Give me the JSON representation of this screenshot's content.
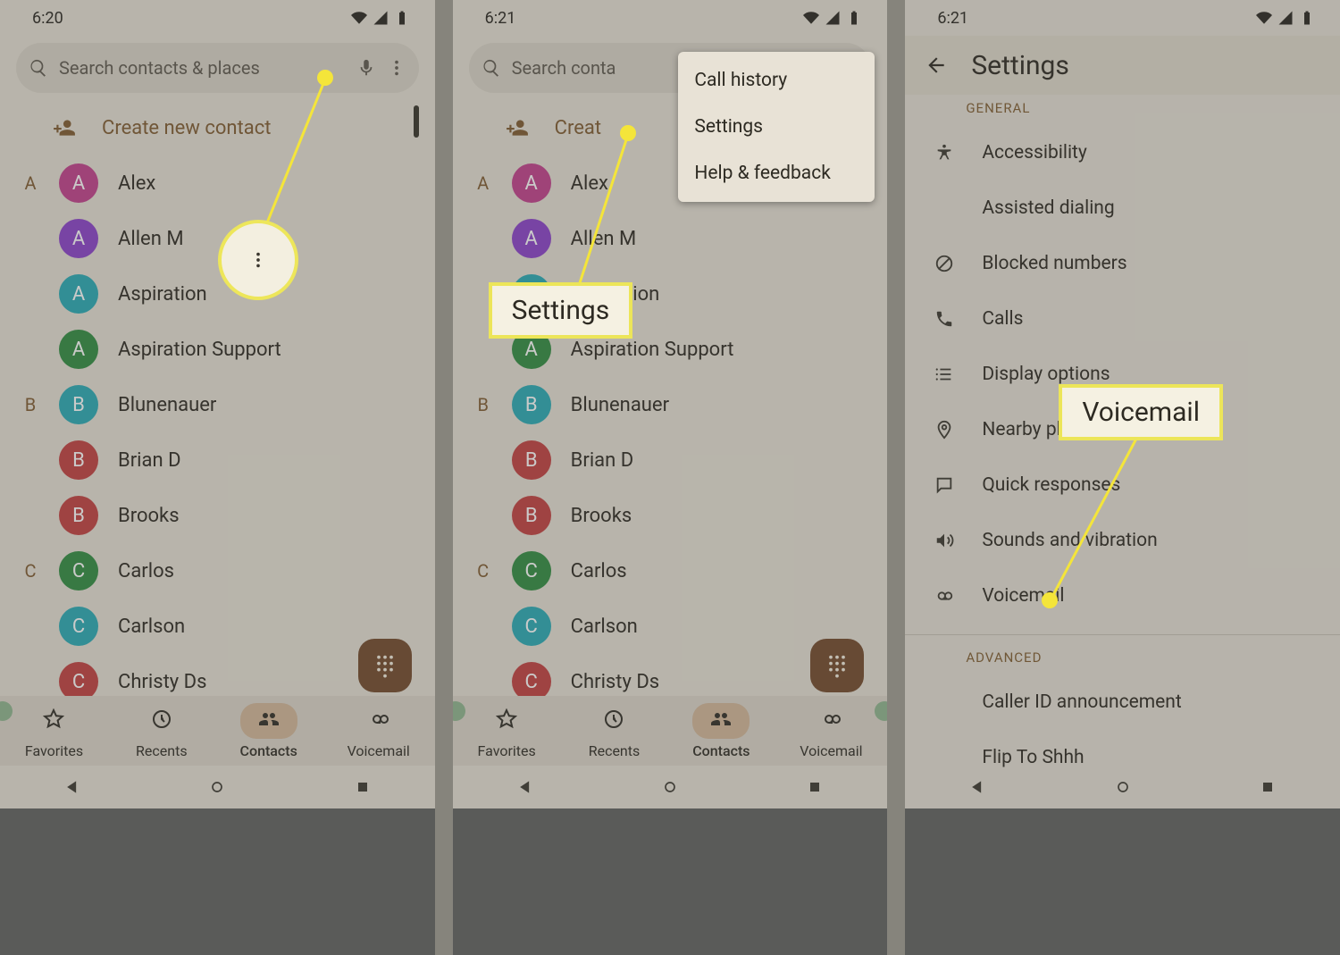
{
  "panels": [
    {
      "time": "6:20"
    },
    {
      "time": "6:21"
    },
    {
      "time": "6:21"
    }
  ],
  "search": {
    "placeholder": "Search contacts & places",
    "placeholder_short": "Search conta"
  },
  "create_label": "Create new contact",
  "create_label_short": "Creat",
  "contacts": [
    {
      "section": "A",
      "name": "Alex",
      "initial": "A",
      "color": "#c23e8b"
    },
    {
      "section": "",
      "name": "Allen M",
      "initial": "A",
      "color": "#8a3fca"
    },
    {
      "section": "",
      "name": "Aspiration",
      "initial": "A",
      "color": "#26aab5"
    },
    {
      "section": "",
      "name": "Aspiration Support",
      "initial": "A",
      "color": "#2f8b3f"
    },
    {
      "section": "B",
      "name": "Blunenauer",
      "initial": "B",
      "color": "#27aab5"
    },
    {
      "section": "",
      "name": "Brian D",
      "initial": "B",
      "color": "#c23e3e"
    },
    {
      "section": "",
      "name": "Brooks",
      "initial": "B",
      "color": "#c23e3e"
    },
    {
      "section": "C",
      "name": "Carlos",
      "initial": "C",
      "color": "#2f8b3f"
    },
    {
      "section": "",
      "name": "Carlson",
      "initial": "C",
      "color": "#27aab5"
    },
    {
      "section": "",
      "name": "Christy Ds",
      "initial": "C",
      "color": "#c23e3e"
    }
  ],
  "nav": {
    "favorites": "Favorites",
    "recents": "Recents",
    "contacts": "Contacts",
    "voicemail": "Voicemail"
  },
  "overflow": {
    "call_history": "Call history",
    "settings": "Settings",
    "help": "Help & feedback"
  },
  "callouts": {
    "settings": "Settings",
    "voicemail": "Voicemail"
  },
  "settings": {
    "title": "Settings",
    "section_general": "GENERAL",
    "section_advanced": "ADVANCED",
    "items": {
      "accessibility": "Accessibility",
      "assisted": "Assisted dialing",
      "blocked": "Blocked numbers",
      "calls": "Calls",
      "display": "Display options",
      "nearby": "Nearby plac",
      "quick": "Quick responses",
      "sounds": "Sounds and vibration",
      "voicemail": "Voicemail",
      "callerid": "Caller ID announcement",
      "flip": "Flip To Shhh"
    }
  }
}
